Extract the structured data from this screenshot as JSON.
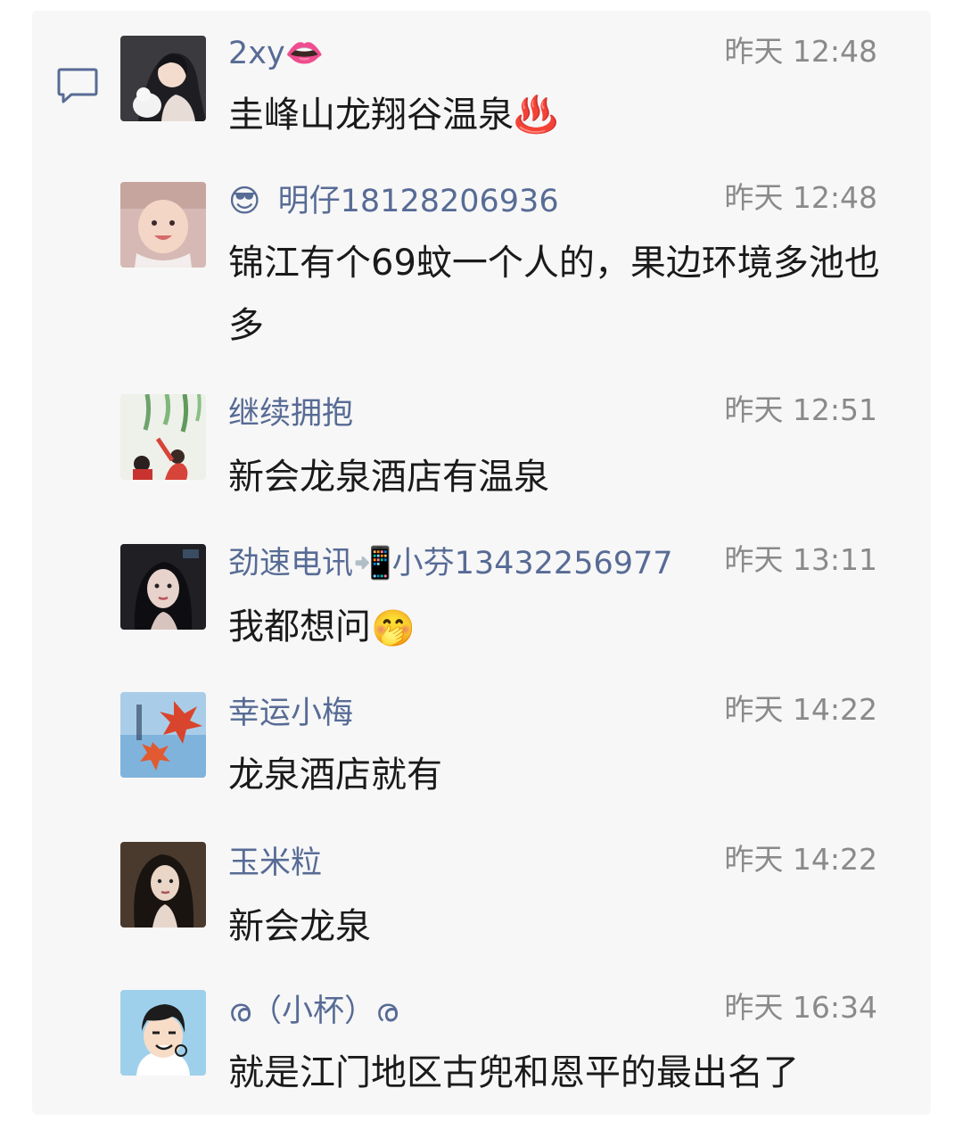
{
  "comments": [
    {
      "author": "2xy👄",
      "time": "昨天 12:48",
      "text": "圭峰山龙翔谷温泉♨️",
      "avatar": "anime-girl-with-cat-avatar"
    },
    {
      "author_emoji": "😎",
      "author": "明仔18128206936",
      "time": "昨天 12:48",
      "text": "锦江有个69蚊一个人的，果边环境多池也多",
      "avatar": "baby-photo-avatar"
    },
    {
      "author": "继续拥抱",
      "time": "昨天 12:51",
      "text": "新会龙泉酒店有温泉",
      "avatar": "kids-under-leaves-avatar"
    },
    {
      "author": "劲速电讯📲小芬13432256977",
      "time": "昨天 13:11",
      "text": "我都想问",
      "text_emoji": "🤭",
      "avatar": "dark-portrait-avatar"
    },
    {
      "author": "幸运小梅",
      "time": "昨天 14:22",
      "text": "龙泉酒店就有",
      "avatar": "maple-leaves-avatar"
    },
    {
      "author": "玉米粒",
      "time": "昨天 14:22",
      "text": "新会龙泉",
      "avatar": "woman-long-hair-avatar"
    },
    {
      "author": "ര（小杯）ര",
      "time": "昨天 16:34",
      "text": "就是江门地区古兜和恩平的最出名了",
      "avatar": "cartoon-boy-avatar"
    }
  ],
  "colors": {
    "author": "#576b95",
    "time": "#8a8a8a",
    "text": "#1a1a1a",
    "panel": "#f7f7f7"
  },
  "icons": {
    "comment": "speech-bubble-icon"
  }
}
